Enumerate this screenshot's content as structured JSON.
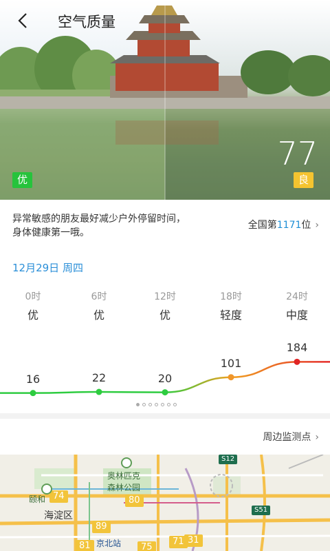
{
  "header": {
    "title": "空气质量"
  },
  "hero": {
    "aqi_value": "77",
    "left_level": "优",
    "right_level": "良",
    "colors": {
      "good": "#26c33c",
      "moderate": "#f5c430"
    }
  },
  "advice": {
    "lines": [
      "异常敏感的朋友最好减少户外停留时间，",
      "身体健康第一哦。"
    ],
    "rank_prefix": "全国第",
    "rank_number": "1171",
    "rank_suffix": "位"
  },
  "forecast": {
    "date": "12月29日 周四",
    "slots": [
      {
        "time": "0时",
        "level": "优"
      },
      {
        "time": "6时",
        "level": "优"
      },
      {
        "time": "12时",
        "level": "优"
      },
      {
        "time": "18时",
        "level": "轻度"
      },
      {
        "time": "24时",
        "level": "中度"
      }
    ],
    "values": [
      "16",
      "22",
      "20",
      "101",
      "184"
    ]
  },
  "chart_data": {
    "type": "line",
    "categories": [
      "0时",
      "6时",
      "12时",
      "18时",
      "24时"
    ],
    "values": [
      16,
      22,
      20,
      101,
      184
    ]
  },
  "pager": {
    "total": 7,
    "active": 0
  },
  "nearby": {
    "label": "周边监测点"
  },
  "map": {
    "labels": {
      "district": "海淀区",
      "park_line1": "奥林匹克",
      "park_line2": "森林公园",
      "heyuan": "颐和",
      "station": "京北站"
    },
    "route_signs": [
      "74",
      "80",
      "89",
      "81",
      "75",
      "71",
      "31"
    ],
    "shields": [
      "S12",
      "S51"
    ]
  }
}
